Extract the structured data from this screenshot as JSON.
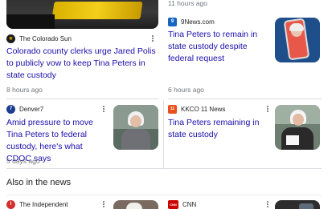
{
  "top": {
    "left_image_alt": "news photo",
    "right_time": "11 hours ago"
  },
  "cards": [
    {
      "source": "The Colorado Sun",
      "favicon_letter": "☀",
      "favicon_color": "#1a1a1a",
      "headline": "Colorado county clerks urge Jared Polis to publicly vow to keep Tina Peters in state custody",
      "time": "8 hours ago"
    },
    {
      "source": "9News.com",
      "favicon_letter": "9",
      "favicon_color": "#1565c0",
      "headline": "Tina Peters to remain in state custody despite federal request",
      "time": "6 hours ago"
    },
    {
      "source": "Denver7",
      "favicon_letter": "7",
      "favicon_color": "#1a3d8f",
      "headline": "Amid pressure to move Tina Peters to federal custody, here's what CDOC says",
      "time": "5 days ago"
    },
    {
      "source": "KKCO 11 News",
      "favicon_letter": "11",
      "favicon_color": "#e8501c",
      "headline": "Tina Peters remaining in state custody",
      "time": ""
    }
  ],
  "section": {
    "title": "Also in the news"
  },
  "bottom_cards": [
    {
      "source": "The Independent",
      "favicon_letter": "I",
      "favicon_color": "#d32f2f"
    },
    {
      "source": "CNN",
      "favicon_letter": "CNN",
      "favicon_color": "#cc0000"
    }
  ]
}
